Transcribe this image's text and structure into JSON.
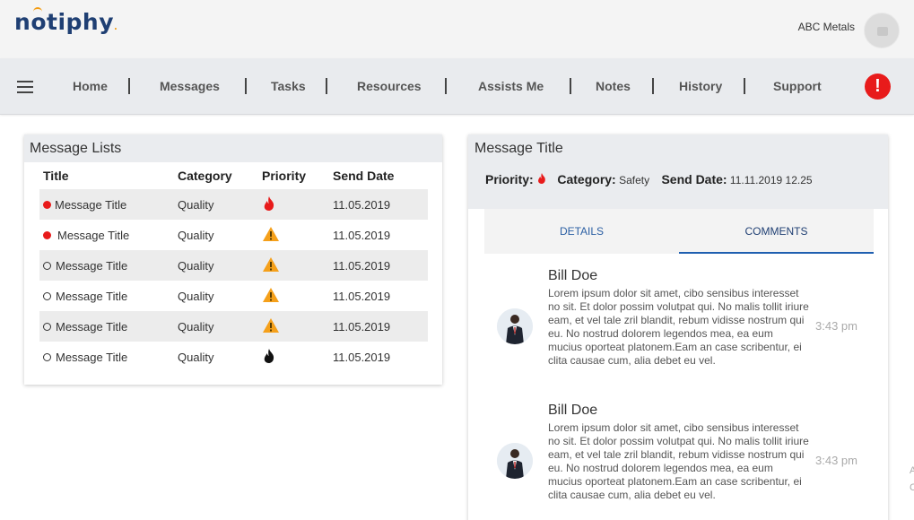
{
  "header": {
    "logo": "notiphy",
    "company": "ABC Metals"
  },
  "nav": {
    "items": [
      "Home",
      "Messages",
      "Tasks",
      "Resources",
      "Assists Me",
      "Notes",
      "History",
      "Support"
    ],
    "alert_label": "!"
  },
  "message_list": {
    "title": "Message Lists",
    "columns": [
      "Title",
      "Category",
      "Priority",
      "Send Date"
    ],
    "rows": [
      {
        "title": "Message Title",
        "category": "Quality",
        "priority": "fire-red",
        "date": "11.05.2019",
        "unread": true
      },
      {
        "title": "Message Title",
        "category": "Quality",
        "priority": "warning",
        "date": "11.05.2019",
        "unread": true
      },
      {
        "title": "Message Title",
        "category": "Quality",
        "priority": "warning",
        "date": "11.05.2019",
        "unread": false
      },
      {
        "title": "Message Title",
        "category": "Quality",
        "priority": "warning",
        "date": "11.05.2019",
        "unread": false
      },
      {
        "title": "Message Title",
        "category": "Quality",
        "priority": "warning",
        "date": "11.05.2019",
        "unread": false
      },
      {
        "title": "Message Title",
        "category": "Quality",
        "priority": "fire-black",
        "date": "11.05.2019",
        "unread": false
      }
    ]
  },
  "detail": {
    "title": "Message Title",
    "priority_label": "Priority:",
    "category_label": "Category:",
    "category_value": "Safety",
    "send_date_label": "Send Date:",
    "send_date_value": "11.11.2019 12.25",
    "tabs": [
      "DETAILS",
      "COMMENTS"
    ],
    "active_tab": "COMMENTS",
    "comments": [
      {
        "name": "Bill Doe",
        "text": "Lorem ipsum dolor sit amet, cibo sensibus interesset no sit. Et dolor possim volutpat qui. No malis tollit iriure eam, et vel tale zril blandit, rebum vidisse nostrum qui eu. No nostrud dolorem legendos mea, ea eum mucius oporteat platonem.Eam an case scribentur, ei clita causae cum, alia debet eu vel.",
        "time": "3:43 pm"
      },
      {
        "name": "Bill Doe",
        "text": "Lorem ipsum dolor sit amet, cibo sensibus interesset no sit. Et dolor possim volutpat qui. No malis tollit iriure eam, et vel tale zril blandit, rebum vidisse nostrum qui eu. No nostrud dolorem legendos mea, ea eum mucius oporteat platonem.Eam an case scribentur, ei clita causae cum, alia debet eu vel.",
        "time": "3:43 pm"
      }
    ]
  },
  "edge_fragments": [
    "A",
    "C"
  ],
  "colors": {
    "brand_navy": "#1f3f73",
    "brand_orange": "#f39c12",
    "alert_red": "#e81b1b",
    "warning_orange": "#f5a01a",
    "tab_blue": "#1f5fb0"
  }
}
